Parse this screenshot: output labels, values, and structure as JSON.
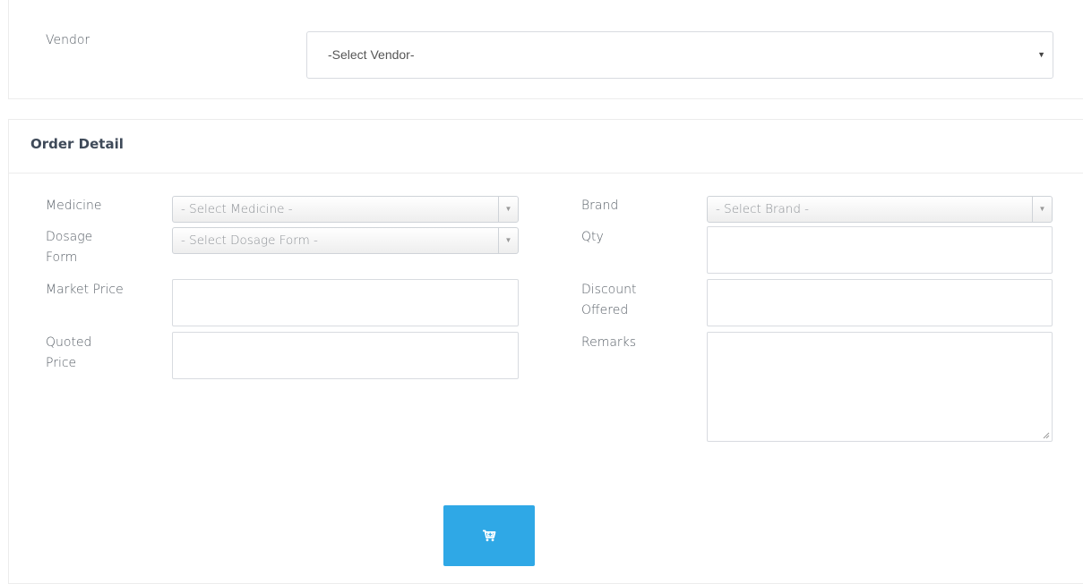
{
  "vendor_section": {
    "label": "Vendor",
    "select_value": "-Select Vendor-"
  },
  "order_detail": {
    "title": "Order Detail",
    "medicine": {
      "label": "Medicine",
      "value": "- Select Medicine -"
    },
    "brand": {
      "label": "Brand",
      "value": "- Select Brand -"
    },
    "dosage_form": {
      "label_line1": "Dosage",
      "label_line2": "Form",
      "value": "- Select Dosage Form -"
    },
    "qty": {
      "label": "Qty",
      "value": ""
    },
    "market_price": {
      "label": "Market Price",
      "value": ""
    },
    "discount_offered": {
      "label_line1": "Discount",
      "label_line2": "Offered",
      "value": ""
    },
    "quoted_price": {
      "label_line1": "Quoted",
      "label_line2": "Price",
      "value": ""
    },
    "remarks": {
      "label": "Remarks",
      "value": ""
    },
    "submit_button": {
      "icon": "cart-plus-icon"
    }
  },
  "colors": {
    "accent": "#2fa8e6",
    "border": "#d8dbe0",
    "title": "#3f4a59"
  }
}
